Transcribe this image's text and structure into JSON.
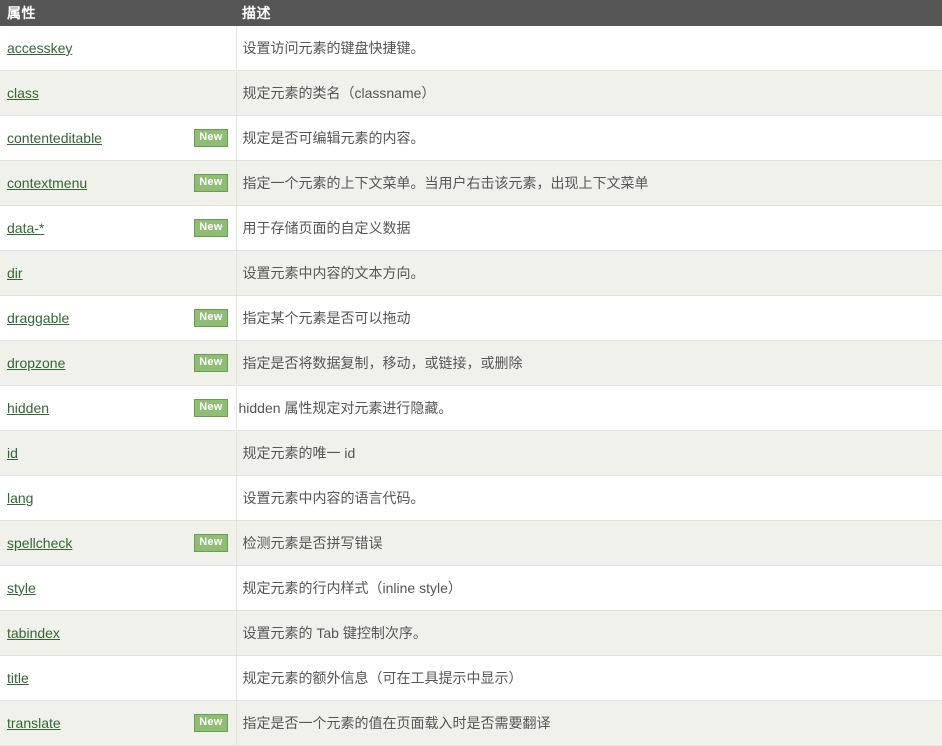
{
  "table": {
    "headers": {
      "attribute": "属性",
      "description": "描述"
    },
    "badge_label": "New",
    "colors": {
      "header_background": "#555555",
      "header_text": "#ffffff",
      "link": "#336633",
      "row_even_background": "#f1f1ec",
      "row_odd_background": "#ffffff",
      "badge_background": "#8ebd73",
      "badge_border": "#6a9c55",
      "badge_text": "#ffffff",
      "body_text": "#555555",
      "row_border": "#e3e3dd"
    },
    "rows": [
      {
        "attribute": "accesskey",
        "new": false,
        "description": "设置访问元素的键盘快捷键。"
      },
      {
        "attribute": "class",
        "new": false,
        "description": "规定元素的类名（classname）"
      },
      {
        "attribute": "contenteditable",
        "new": true,
        "description": "规定是否可编辑元素的内容。"
      },
      {
        "attribute": "contextmenu",
        "new": true,
        "description": "指定一个元素的上下文菜单。当用户右击该元素，出现上下文菜单"
      },
      {
        "attribute": "data-*",
        "new": true,
        "description": "用于存储页面的自定义数据"
      },
      {
        "attribute": "dir",
        "new": false,
        "description": "设置元素中内容的文本方向。"
      },
      {
        "attribute": "draggable",
        "new": true,
        "description": "指定某个元素是否可以拖动"
      },
      {
        "attribute": "dropzone",
        "new": true,
        "description": "指定是否将数据复制，移动，或链接，或删除"
      },
      {
        "attribute": "hidden",
        "new": true,
        "description": "hidden 属性规定对元素进行隐藏。"
      },
      {
        "attribute": "id",
        "new": false,
        "description": "规定元素的唯一 id"
      },
      {
        "attribute": "lang",
        "new": false,
        "description": "设置元素中内容的语言代码。"
      },
      {
        "attribute": "spellcheck",
        "new": true,
        "description": "检测元素是否拼写错误"
      },
      {
        "attribute": "style",
        "new": false,
        "description": "规定元素的行内样式（inline style）"
      },
      {
        "attribute": "tabindex",
        "new": false,
        "description": "设置元素的 Tab 键控制次序。"
      },
      {
        "attribute": "title",
        "new": false,
        "description": "规定元素的额外信息（可在工具提示中显示）"
      },
      {
        "attribute": "translate",
        "new": true,
        "description": "指定是否一个元素的值在页面载入时是否需要翻译"
      }
    ]
  }
}
